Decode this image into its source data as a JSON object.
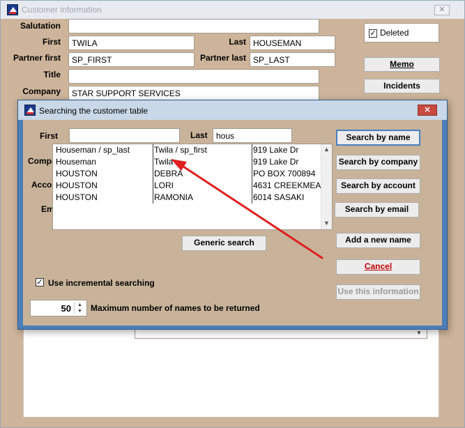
{
  "customer_window": {
    "title": "Customer information",
    "close_glyph": "✕",
    "fields": {
      "salutation": {
        "label": "Salutation",
        "value": ""
      },
      "first": {
        "label": "First",
        "value": "TWILA"
      },
      "last": {
        "label": "Last",
        "value": "HOUSEMAN"
      },
      "partner_first": {
        "label": "Partner first",
        "value": "SP_FIRST"
      },
      "partner_last": {
        "label": "Partner last",
        "value": "SP_LAST"
      },
      "title": {
        "label": "Title",
        "value": ""
      },
      "company": {
        "label": "Company",
        "value": "STAR SUPPORT SERVICES"
      }
    },
    "deleted": {
      "label": "Deleted",
      "checked": true
    },
    "memo_button": "Memo",
    "incidents_button": "Incidents"
  },
  "search_dialog": {
    "title": "Searching the customer table",
    "close_glyph": "✕",
    "first_label": "First",
    "first_value": "",
    "last_label": "Last",
    "last_value": "hous",
    "partial_labels": {
      "company": "Compa",
      "account": "Accou",
      "email": "Em"
    },
    "results": [
      {
        "name": "Houseman / sp_last",
        "first": "Twila / sp_first",
        "address": "919 Lake Dr"
      },
      {
        "name": "Houseman",
        "first": "Twila",
        "address": "919 Lake Dr"
      },
      {
        "name": "HOUSTON",
        "first": "DEBRA",
        "address": "PO BOX 700894"
      },
      {
        "name": "HOUSTON",
        "first": "LORI",
        "address": "4631 CREEKMEA"
      },
      {
        "name": "HOUSTON",
        "first": "RAMONIA",
        "address": "6014 SASAKI"
      }
    ],
    "buttons": {
      "search_by_name": "Search by name",
      "search_by_company": "Search by company",
      "search_by_account": "Search by account",
      "search_by_email": "Search by email",
      "add_new_name": "Add a new name",
      "cancel": "Cancel",
      "use_this_information": "Use this information",
      "generic_search": "Generic search"
    },
    "incremental_search": {
      "label": "Use incremental searching",
      "checked": true
    },
    "max_names": {
      "value": "50",
      "label": "Maximum number of names to be returned"
    }
  },
  "annotation": {
    "arrow_color": "#e02020"
  }
}
